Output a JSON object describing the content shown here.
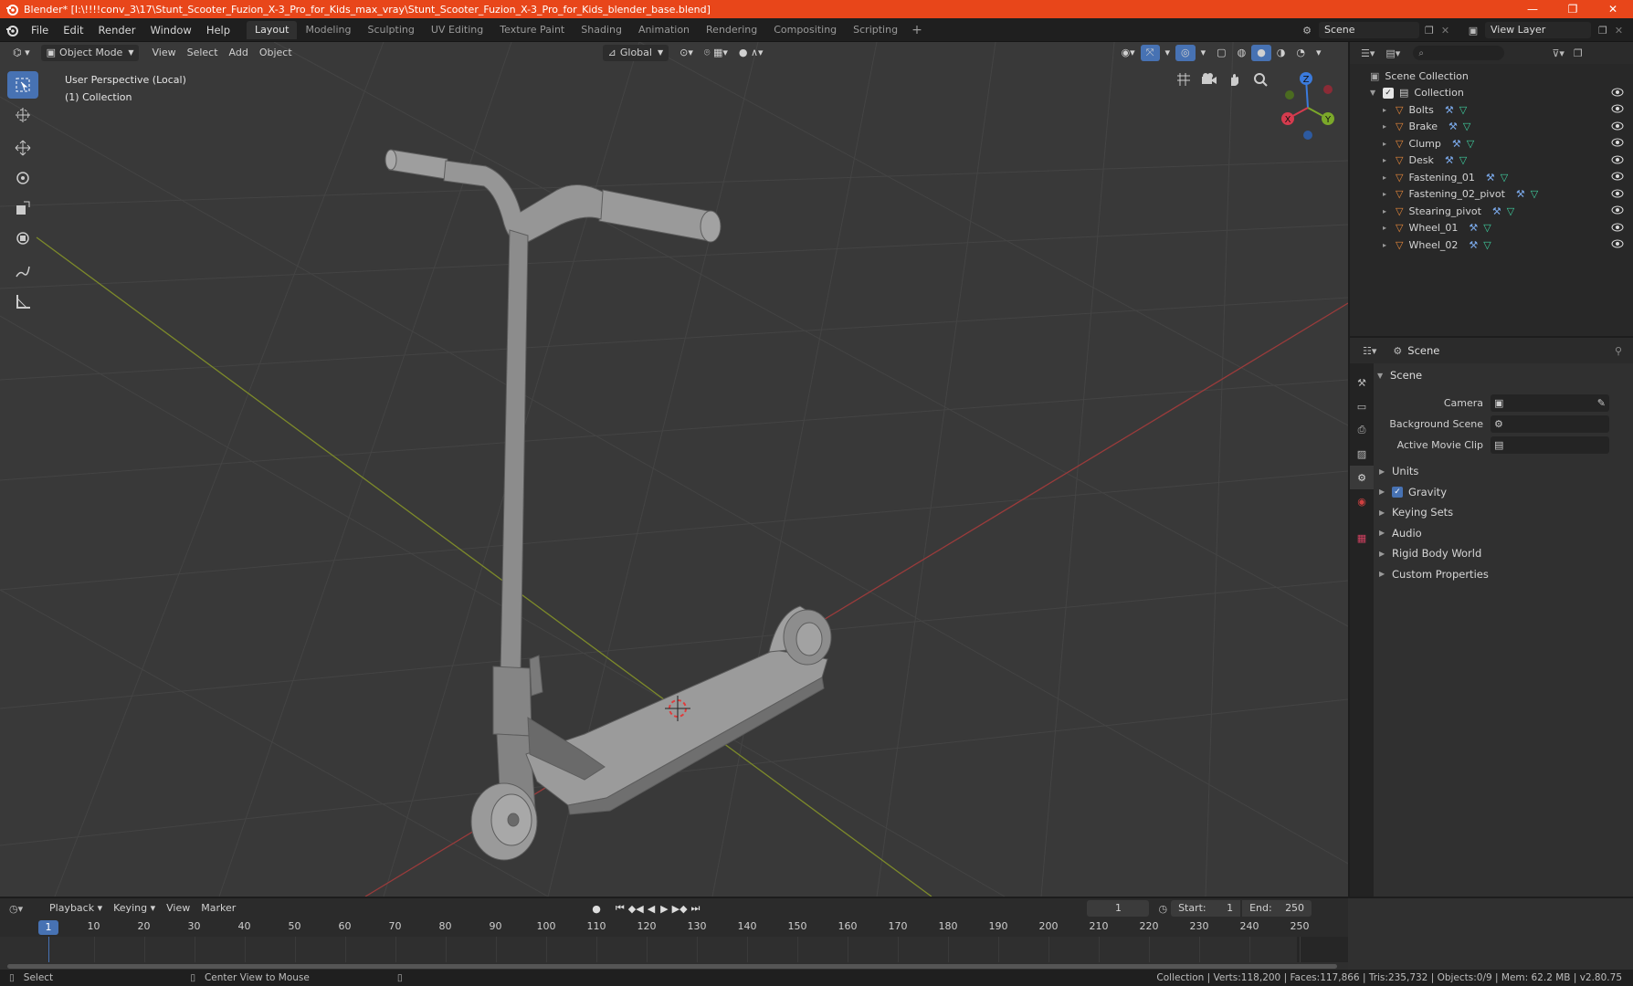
{
  "window": {
    "title": "Blender* [I:\\!!!!conv_3\\17\\Stunt_Scooter_Fuzion_X-3_Pro_for_Kids_max_vray\\Stunt_Scooter_Fuzion_X-3_Pro_for_Kids_blender_base.blend]",
    "controls": [
      "—",
      "❐",
      "✕"
    ]
  },
  "menu": [
    "File",
    "Edit",
    "Render",
    "Window",
    "Help"
  ],
  "workspaces": [
    "Layout",
    "Modeling",
    "Sculpting",
    "UV Editing",
    "Texture Paint",
    "Shading",
    "Animation",
    "Rendering",
    "Compositing",
    "Scripting"
  ],
  "active_workspace": "Layout",
  "scene_name": "Scene",
  "view_layer": "View Layer",
  "viewport": {
    "mode": "Object Mode",
    "menus": [
      "View",
      "Select",
      "Add",
      "Object"
    ],
    "orientation": "Global",
    "info_line1": "User Perspective (Local)",
    "info_line2": "(1) Collection",
    "gizmo_axes": [
      "X",
      "Y",
      "Z"
    ]
  },
  "outliner": {
    "root": "Scene Collection",
    "collection": "Collection",
    "objects": [
      "Bolts",
      "Brake",
      "Clump",
      "Desk",
      "Fastening_01",
      "Fastening_02_pivot",
      "Stearing_pivot",
      "Wheel_01",
      "Wheel_02"
    ]
  },
  "properties": {
    "header": "Scene",
    "panel": "Scene",
    "rows": [
      {
        "label": "Camera"
      },
      {
        "label": "Background Scene"
      },
      {
        "label": "Active Movie Clip"
      }
    ],
    "subpanels": [
      "Units",
      "Gravity",
      "Keying Sets",
      "Audio",
      "Rigid Body World",
      "Custom Properties"
    ]
  },
  "timeline": {
    "menus": [
      "Playback",
      "Keying",
      "View",
      "Marker"
    ],
    "current_frame": "1",
    "start_label": "Start:",
    "start": "1",
    "end_label": "End:",
    "end": "250",
    "ticks": [
      "1",
      "10",
      "20",
      "30",
      "40",
      "50",
      "60",
      "70",
      "80",
      "90",
      "100",
      "110",
      "120",
      "130",
      "140",
      "150",
      "160",
      "170",
      "180",
      "190",
      "200",
      "210",
      "220",
      "230",
      "240",
      "250"
    ]
  },
  "status": {
    "left": "Select",
    "middle": "Center View to Mouse",
    "right": "Collection | Verts:118,200 | Faces:117,866 | Tris:235,732 | Objects:0/9 | Mem: 62.2 MB | v2.80.75"
  }
}
